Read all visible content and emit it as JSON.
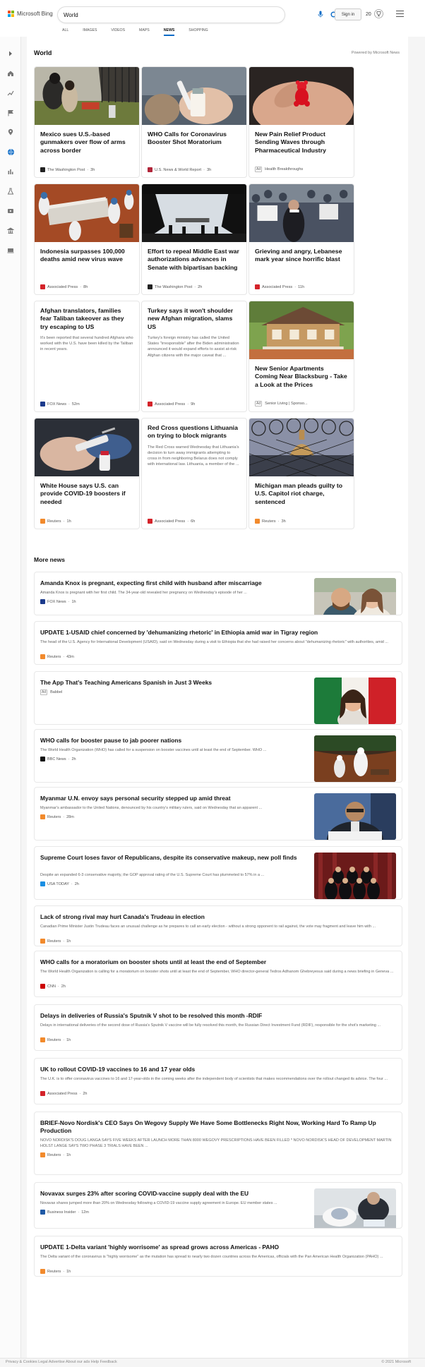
{
  "header": {
    "logo_text": "Microsoft Bing",
    "search_value": "World",
    "signin_label": "Sign in",
    "rewards_count": "20"
  },
  "tabs": [
    {
      "label": "ALL"
    },
    {
      "label": "IMAGES"
    },
    {
      "label": "VIDEOS"
    },
    {
      "label": "MAPS"
    },
    {
      "label": "NEWS",
      "active": true
    },
    {
      "label": "SHOPPING"
    }
  ],
  "rail_icons": [
    "chevron-right-icon",
    "home-icon",
    "trending-icon",
    "flag-icon",
    "location-icon",
    "globe-icon",
    "business-icon",
    "science-icon",
    "entertainment-icon",
    "politics-icon",
    "tech-icon"
  ],
  "section": {
    "title": "World",
    "powered_by": "Powered by Microsoft News"
  },
  "cards": [
    {
      "title": "Mexico sues U.S.-based gunmakers over flow of arms across border",
      "source": "The Washington Post",
      "time": "3h",
      "fav_color": "#222222",
      "img": "mexico"
    },
    {
      "title": "WHO Calls for Coronavirus Booster Shot Moratorium",
      "source": "U.S. News & World Report",
      "time": "3h",
      "fav_color": "#b1263a",
      "img": "vaccine"
    },
    {
      "title": "New Pain Relief Product Sending Waves through Pharmaceutical Industry",
      "source": "Health Breakthroughs",
      "time": "",
      "ad": "Ad",
      "fav_color": "",
      "img": "gummy"
    },
    {
      "title": "Indonesia surpasses 100,000 deaths amid new virus wave",
      "source": "Associated Press",
      "time": "8h",
      "fav_color": "#d4232a",
      "img": "coffin"
    },
    {
      "title": "Effort to repeal Middle East war authorizations advances in Senate with bipartisan backing",
      "source": "The Washington Post",
      "time": "2h",
      "fav_color": "#222222",
      "img": "plane"
    },
    {
      "title": "Grieving and angry, Lebanese mark year since horrific blast",
      "source": "Associated Press",
      "time": "11h",
      "fav_color": "#d4232a",
      "img": "crowd"
    },
    {
      "title": "Afghan translators, families fear Taliban takeover as they try escaping to US",
      "snippet": "It's been reported that several hundred Afghans who worked with the U.S. have been killed by the Taliban in recent years.",
      "source": "FOX News",
      "time": "52m",
      "fav_color": "#1b3a8c",
      "img": ""
    },
    {
      "title": "Turkey says it won't shoulder new Afghan migration, slams US",
      "snippet": "Turkey's foreign ministry has called the United States \"irresponsible\" after the Biden administration announced it would expand efforts to assist at-risk Afghan citizens with the major caveat that ...",
      "source": "Associated Press",
      "time": "9h",
      "fav_color": "#d4232a",
      "img": ""
    },
    {
      "title": "New Senior Apartments Coming Near Blacksburg - Take a Look at the Prices",
      "source": "Senior Living | Sponso...",
      "time": "",
      "ad": "Ad",
      "fav_color": "",
      "img": "house"
    },
    {
      "title": "White House says U.S. can provide COVID-19 boosters if needed",
      "source": "Reuters",
      "time": "1h",
      "fav_color": "#f28a2c",
      "img": "syringe"
    },
    {
      "title": "Red Cross questions Lithuania on trying to block migrants",
      "snippet": "The Red Cross warned Wednesday that Lithuania's decision to turn away immigrants attempting to cross in from neighboring Belarus does not comply with international law. Lithuania, a member of the ...",
      "source": "Associated Press",
      "time": "6h",
      "fav_color": "#d4232a",
      "img": ""
    },
    {
      "title": "Michigan man pleads guilty to U.S. Capitol riot charge, sentenced",
      "source": "Reuters",
      "time": "3h",
      "fav_color": "#f28a2c",
      "img": "fence"
    }
  ],
  "more_news": {
    "title": "More news",
    "items": [
      {
        "title": "Amanda Knox is pregnant, expecting first child with husband after miscarriage",
        "snippet": "Amanda Knox is pregnant with her first child. The 34-year-old revealed her pregnancy on Wednesday's episode of her ...",
        "source": "FOX News",
        "time": "1h",
        "fav_color": "#1b3a8c",
        "img": "couple"
      },
      {
        "title": "UPDATE 1-USAID chief concerned by 'dehumanizing rhetoric' in Ethiopia amid war in Tigray region",
        "snippet": "The head of the U.S. Agency for International Development (USAID), said on Wednesday during a visit to Ethiopia that she had raised her concerns about \"dehumanizing rhetoric\" with authorities, amid ...",
        "source": "Reuters",
        "time": "43m",
        "fav_color": "#f28a2c",
        "img": ""
      },
      {
        "title": "The App That's Teaching Americans Spanish in Just 3 Weeks",
        "snippet": "",
        "source": "Babbel",
        "time": "",
        "ad": "Ad",
        "fav_color": "",
        "img": "flag"
      },
      {
        "title": "WHO calls for booster pause to jab poorer nations",
        "snippet": "The World Health Organization (WHO) has called for a suspension on booster vaccines until at least the end of September. WHO ...",
        "source": "BBC News",
        "time": "2h",
        "fav_color": "#111111",
        "img": "grave"
      },
      {
        "title": "Myanmar U.N. envoy says personal security stepped up amid threat",
        "snippet": "Myanmar's ambassador to the United Nations, denounced by his country's military rulers, said on Wednesday that an apparent ...",
        "source": "Reuters",
        "time": "28m",
        "fav_color": "#f28a2c",
        "img": "envoy"
      },
      {
        "title": "Supreme Court loses favor of Republicans, despite its conservative makeup, new poll finds",
        "snippet": "Despite an expanded 6-3 conservative majority, the GOP approval rating of the U.S. Supreme Court has plummeted to 57% in a ...",
        "source": "USA TODAY",
        "time": "2h",
        "fav_color": "#1a8fe3",
        "img": "court"
      },
      {
        "title": "Lack of strong rival may hurt Canada's Trudeau in election",
        "snippet": "Canadian Prime Minister Justin Trudeau faces an unusual challenge as he prepares to call an early election - without a strong opponent to rail against, the vote may fragment and leave him with ...",
        "source": "Reuters",
        "time": "1h",
        "fav_color": "#f28a2c",
        "img": ""
      },
      {
        "title": "WHO calls for a moratorium on booster shots until at least the end of September",
        "snippet": "The World Health Organization is calling for a moratorium on booster shots until at least the end of September, WHO director-general Tedros Adhanom Ghebreyesus said during a news briefing in Geneva ...",
        "source": "CNN",
        "time": "2h",
        "fav_color": "#cc0000",
        "img": ""
      },
      {
        "title": "Delays in deliveries of Russia's Sputnik V shot to be resolved this month -RDIF",
        "snippet": "Delays in international deliveries of the second dose of Russia's Sputnik V vaccine will be fully resolved this month, the Russian Direct Investment Fund (RDIF), responsible for the shot's marketing ...",
        "source": "Reuters",
        "time": "1h",
        "fav_color": "#f28a2c",
        "img": ""
      },
      {
        "title": "UK to rollout COVID-19 vaccines to 16 and 17 year olds",
        "snippet": "The U.K. is to offer coronavirus vaccines to 16 and 17-year-olds in the coming weeks after the independent body of scientists that makes recommendations over the rollout changed its advice. The four ...",
        "source": "Associated Press",
        "time": "2h",
        "fav_color": "#d4232a",
        "img": ""
      },
      {
        "title": "BRIEF-Novo Nordisk's CEO Says On Wegovy Supply We Have Some Bottlenecks Right Now, Working Hard To Ramp Up Production",
        "snippet": "NOVO NORDISK'S DOUG LANGA SAYS FIVE WEEKS AFTER LAUNCH MORE THAN 8000 WEGOVY PRESCRIPTIONS HAVE BEEN FILLED * NOVO NORDISK'S HEAD OF DEVELOPMENT MARTIN HOLST LANGE SAYS TWO PHASE 3 TRIALS HAVE BEEN ...",
        "source": "Reuters",
        "time": "1h",
        "fav_color": "#f28a2c",
        "img": ""
      },
      {
        "title": "Novavax surges 23% after scoring COVID-vaccine supply deal with the EU",
        "snippet": "Novavax shares jumped more than 20% on Wednesday following a COVID-19 vaccine supply agreement in Europe. EU member states ...",
        "source": "Business Insider",
        "time": "12m",
        "fav_color": "#1f5aa6",
        "img": "lab"
      },
      {
        "title": "UPDATE 1-Delta variant 'highly worrisome' as spread grows across Americas - PAHO",
        "snippet": "The Delta variant of the coronavirus is \"highly worrisome\" as the mutation has spread to nearly two dozen countries across the Americas, officials with the Pan American Health Organization (PAHO) ...",
        "source": "Reuters",
        "time": "1h",
        "fav_color": "#f28a2c",
        "img": ""
      }
    ]
  },
  "footer": {
    "left": "Privacy & Cookies  Legal  Advertise  About our ads  Help  Feedback",
    "right": "© 2021 Microsoft"
  }
}
